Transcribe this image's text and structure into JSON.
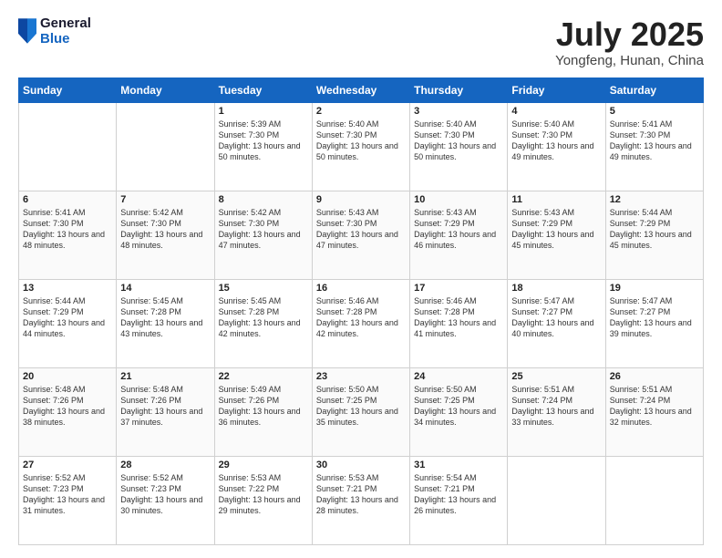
{
  "logo": {
    "general": "General",
    "blue": "Blue"
  },
  "title": {
    "month": "July 2025",
    "location": "Yongfeng, Hunan, China"
  },
  "days_of_week": [
    "Sunday",
    "Monday",
    "Tuesday",
    "Wednesday",
    "Thursday",
    "Friday",
    "Saturday"
  ],
  "weeks": [
    [
      {
        "day": "",
        "info": ""
      },
      {
        "day": "",
        "info": ""
      },
      {
        "day": "1",
        "info": "Sunrise: 5:39 AM\nSunset: 7:30 PM\nDaylight: 13 hours and 50 minutes."
      },
      {
        "day": "2",
        "info": "Sunrise: 5:40 AM\nSunset: 7:30 PM\nDaylight: 13 hours and 50 minutes."
      },
      {
        "day": "3",
        "info": "Sunrise: 5:40 AM\nSunset: 7:30 PM\nDaylight: 13 hours and 50 minutes."
      },
      {
        "day": "4",
        "info": "Sunrise: 5:40 AM\nSunset: 7:30 PM\nDaylight: 13 hours and 49 minutes."
      },
      {
        "day": "5",
        "info": "Sunrise: 5:41 AM\nSunset: 7:30 PM\nDaylight: 13 hours and 49 minutes."
      }
    ],
    [
      {
        "day": "6",
        "info": "Sunrise: 5:41 AM\nSunset: 7:30 PM\nDaylight: 13 hours and 48 minutes."
      },
      {
        "day": "7",
        "info": "Sunrise: 5:42 AM\nSunset: 7:30 PM\nDaylight: 13 hours and 48 minutes."
      },
      {
        "day": "8",
        "info": "Sunrise: 5:42 AM\nSunset: 7:30 PM\nDaylight: 13 hours and 47 minutes."
      },
      {
        "day": "9",
        "info": "Sunrise: 5:43 AM\nSunset: 7:30 PM\nDaylight: 13 hours and 47 minutes."
      },
      {
        "day": "10",
        "info": "Sunrise: 5:43 AM\nSunset: 7:29 PM\nDaylight: 13 hours and 46 minutes."
      },
      {
        "day": "11",
        "info": "Sunrise: 5:43 AM\nSunset: 7:29 PM\nDaylight: 13 hours and 45 minutes."
      },
      {
        "day": "12",
        "info": "Sunrise: 5:44 AM\nSunset: 7:29 PM\nDaylight: 13 hours and 45 minutes."
      }
    ],
    [
      {
        "day": "13",
        "info": "Sunrise: 5:44 AM\nSunset: 7:29 PM\nDaylight: 13 hours and 44 minutes."
      },
      {
        "day": "14",
        "info": "Sunrise: 5:45 AM\nSunset: 7:28 PM\nDaylight: 13 hours and 43 minutes."
      },
      {
        "day": "15",
        "info": "Sunrise: 5:45 AM\nSunset: 7:28 PM\nDaylight: 13 hours and 42 minutes."
      },
      {
        "day": "16",
        "info": "Sunrise: 5:46 AM\nSunset: 7:28 PM\nDaylight: 13 hours and 42 minutes."
      },
      {
        "day": "17",
        "info": "Sunrise: 5:46 AM\nSunset: 7:28 PM\nDaylight: 13 hours and 41 minutes."
      },
      {
        "day": "18",
        "info": "Sunrise: 5:47 AM\nSunset: 7:27 PM\nDaylight: 13 hours and 40 minutes."
      },
      {
        "day": "19",
        "info": "Sunrise: 5:47 AM\nSunset: 7:27 PM\nDaylight: 13 hours and 39 minutes."
      }
    ],
    [
      {
        "day": "20",
        "info": "Sunrise: 5:48 AM\nSunset: 7:26 PM\nDaylight: 13 hours and 38 minutes."
      },
      {
        "day": "21",
        "info": "Sunrise: 5:48 AM\nSunset: 7:26 PM\nDaylight: 13 hours and 37 minutes."
      },
      {
        "day": "22",
        "info": "Sunrise: 5:49 AM\nSunset: 7:26 PM\nDaylight: 13 hours and 36 minutes."
      },
      {
        "day": "23",
        "info": "Sunrise: 5:50 AM\nSunset: 7:25 PM\nDaylight: 13 hours and 35 minutes."
      },
      {
        "day": "24",
        "info": "Sunrise: 5:50 AM\nSunset: 7:25 PM\nDaylight: 13 hours and 34 minutes."
      },
      {
        "day": "25",
        "info": "Sunrise: 5:51 AM\nSunset: 7:24 PM\nDaylight: 13 hours and 33 minutes."
      },
      {
        "day": "26",
        "info": "Sunrise: 5:51 AM\nSunset: 7:24 PM\nDaylight: 13 hours and 32 minutes."
      }
    ],
    [
      {
        "day": "27",
        "info": "Sunrise: 5:52 AM\nSunset: 7:23 PM\nDaylight: 13 hours and 31 minutes."
      },
      {
        "day": "28",
        "info": "Sunrise: 5:52 AM\nSunset: 7:23 PM\nDaylight: 13 hours and 30 minutes."
      },
      {
        "day": "29",
        "info": "Sunrise: 5:53 AM\nSunset: 7:22 PM\nDaylight: 13 hours and 29 minutes."
      },
      {
        "day": "30",
        "info": "Sunrise: 5:53 AM\nSunset: 7:21 PM\nDaylight: 13 hours and 28 minutes."
      },
      {
        "day": "31",
        "info": "Sunrise: 5:54 AM\nSunset: 7:21 PM\nDaylight: 13 hours and 26 minutes."
      },
      {
        "day": "",
        "info": ""
      },
      {
        "day": "",
        "info": ""
      }
    ]
  ]
}
